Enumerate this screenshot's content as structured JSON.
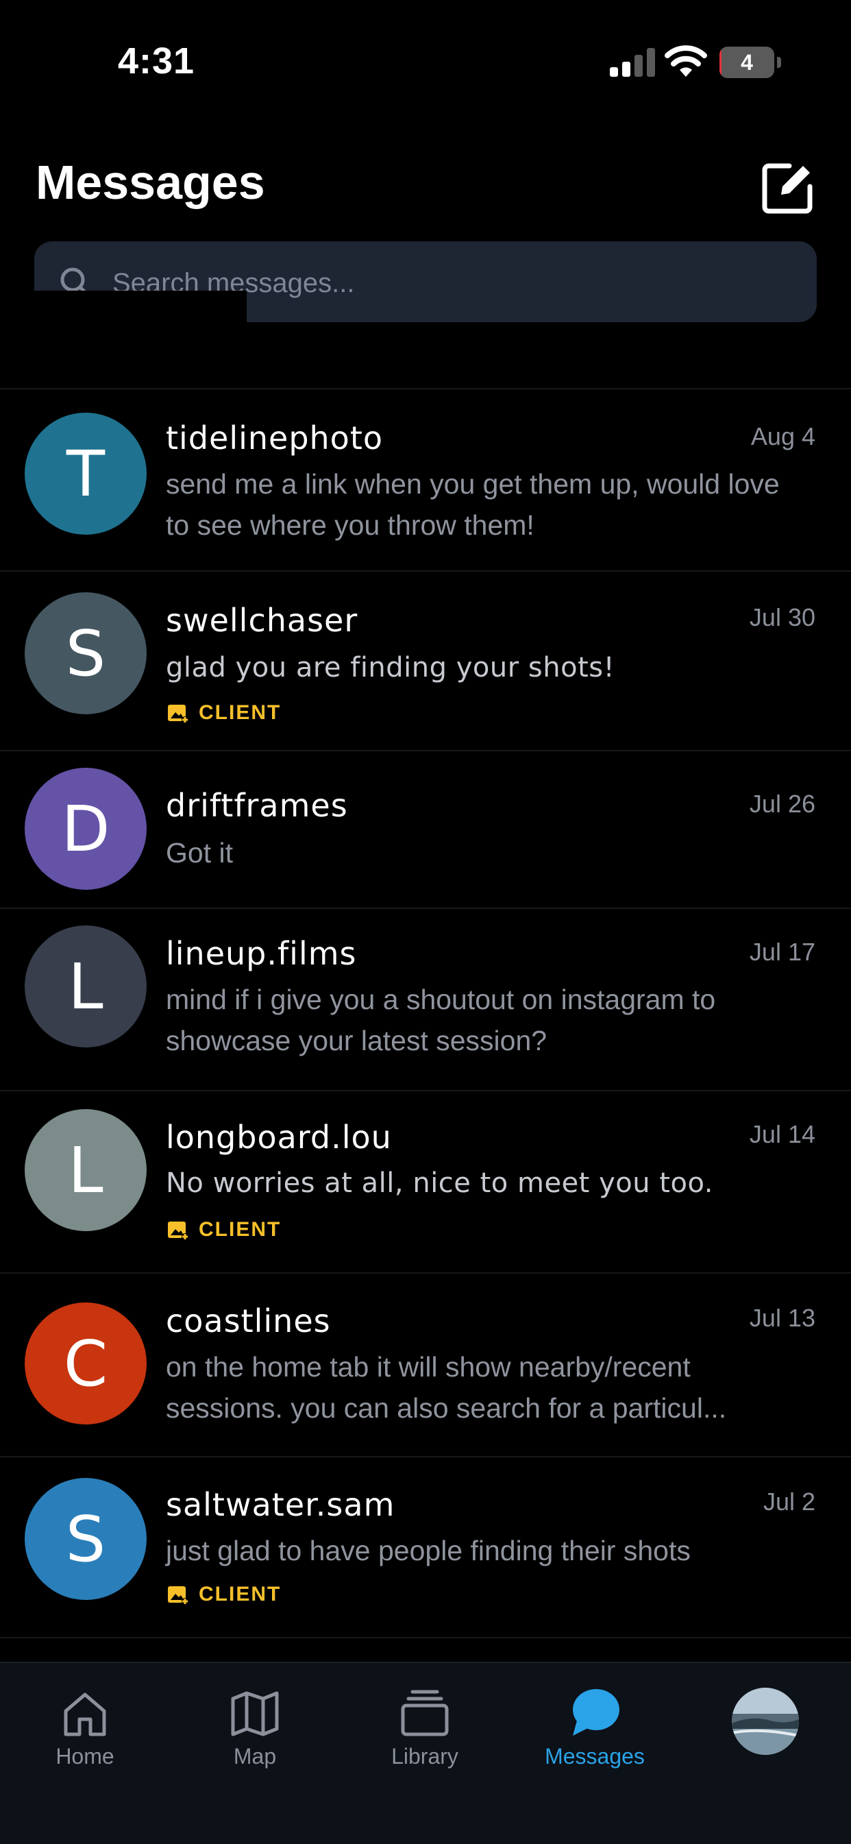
{
  "status_bar": {
    "time": "4:31",
    "battery_level": "4",
    "battery_percent": 4
  },
  "header": {
    "title": "Messages"
  },
  "search": {
    "placeholder": "Search messages..."
  },
  "conversations": [
    {
      "initial": "T",
      "name": "tidelinephoto",
      "date": "Aug 4",
      "preview": "send me a link when you get them up, would love to see where you throw them!",
      "client": false,
      "avatar_color": "#1f7390"
    },
    {
      "initial": "S",
      "name": "swellchaser",
      "date": "Jul 30",
      "preview": "glad you are finding your shots!",
      "client": true,
      "avatar_color": "#455761"
    },
    {
      "initial": "D",
      "name": "driftframes",
      "date": "Jul 26",
      "preview": "Got it",
      "client": false,
      "avatar_color": "#6553a8"
    },
    {
      "initial": "L",
      "name": "lineup.films",
      "date": "Jul 17",
      "preview": "mind if i give you a shoutout on instagram to showcase your latest session?",
      "client": false,
      "avatar_color": "#383e4c"
    },
    {
      "initial": "L",
      "name": "longboard.lou",
      "date": "Jul 14",
      "preview": "No worries at all, nice to meet you too.",
      "client": true,
      "avatar_color": "#7c8c8a"
    },
    {
      "initial": "C",
      "name": "coastlines",
      "date": "Jul 13",
      "preview": "on the home tab it will show nearby/recent sessions. you can also search for a particul...",
      "client": false,
      "avatar_color": "#c8350f"
    },
    {
      "initial": "S",
      "name": "saltwater.sam",
      "date": "Jul 2",
      "preview": "just glad to have people finding their shots",
      "client": true,
      "avatar_color": "#2a7fba"
    }
  ],
  "client_label": "CLIENT",
  "tabs": [
    {
      "label": "Home",
      "icon": "home-icon",
      "active": false
    },
    {
      "label": "Map",
      "icon": "map-icon",
      "active": false
    },
    {
      "label": "Library",
      "icon": "library-icon",
      "active": false
    },
    {
      "label": "Messages",
      "icon": "chat-bubble-icon",
      "active": true
    }
  ],
  "colors": {
    "accent": "#2aa3e8",
    "client_badge": "#f7c02a",
    "search_bg": "#1e2533",
    "tab_bar_bg": "#0d1118"
  }
}
